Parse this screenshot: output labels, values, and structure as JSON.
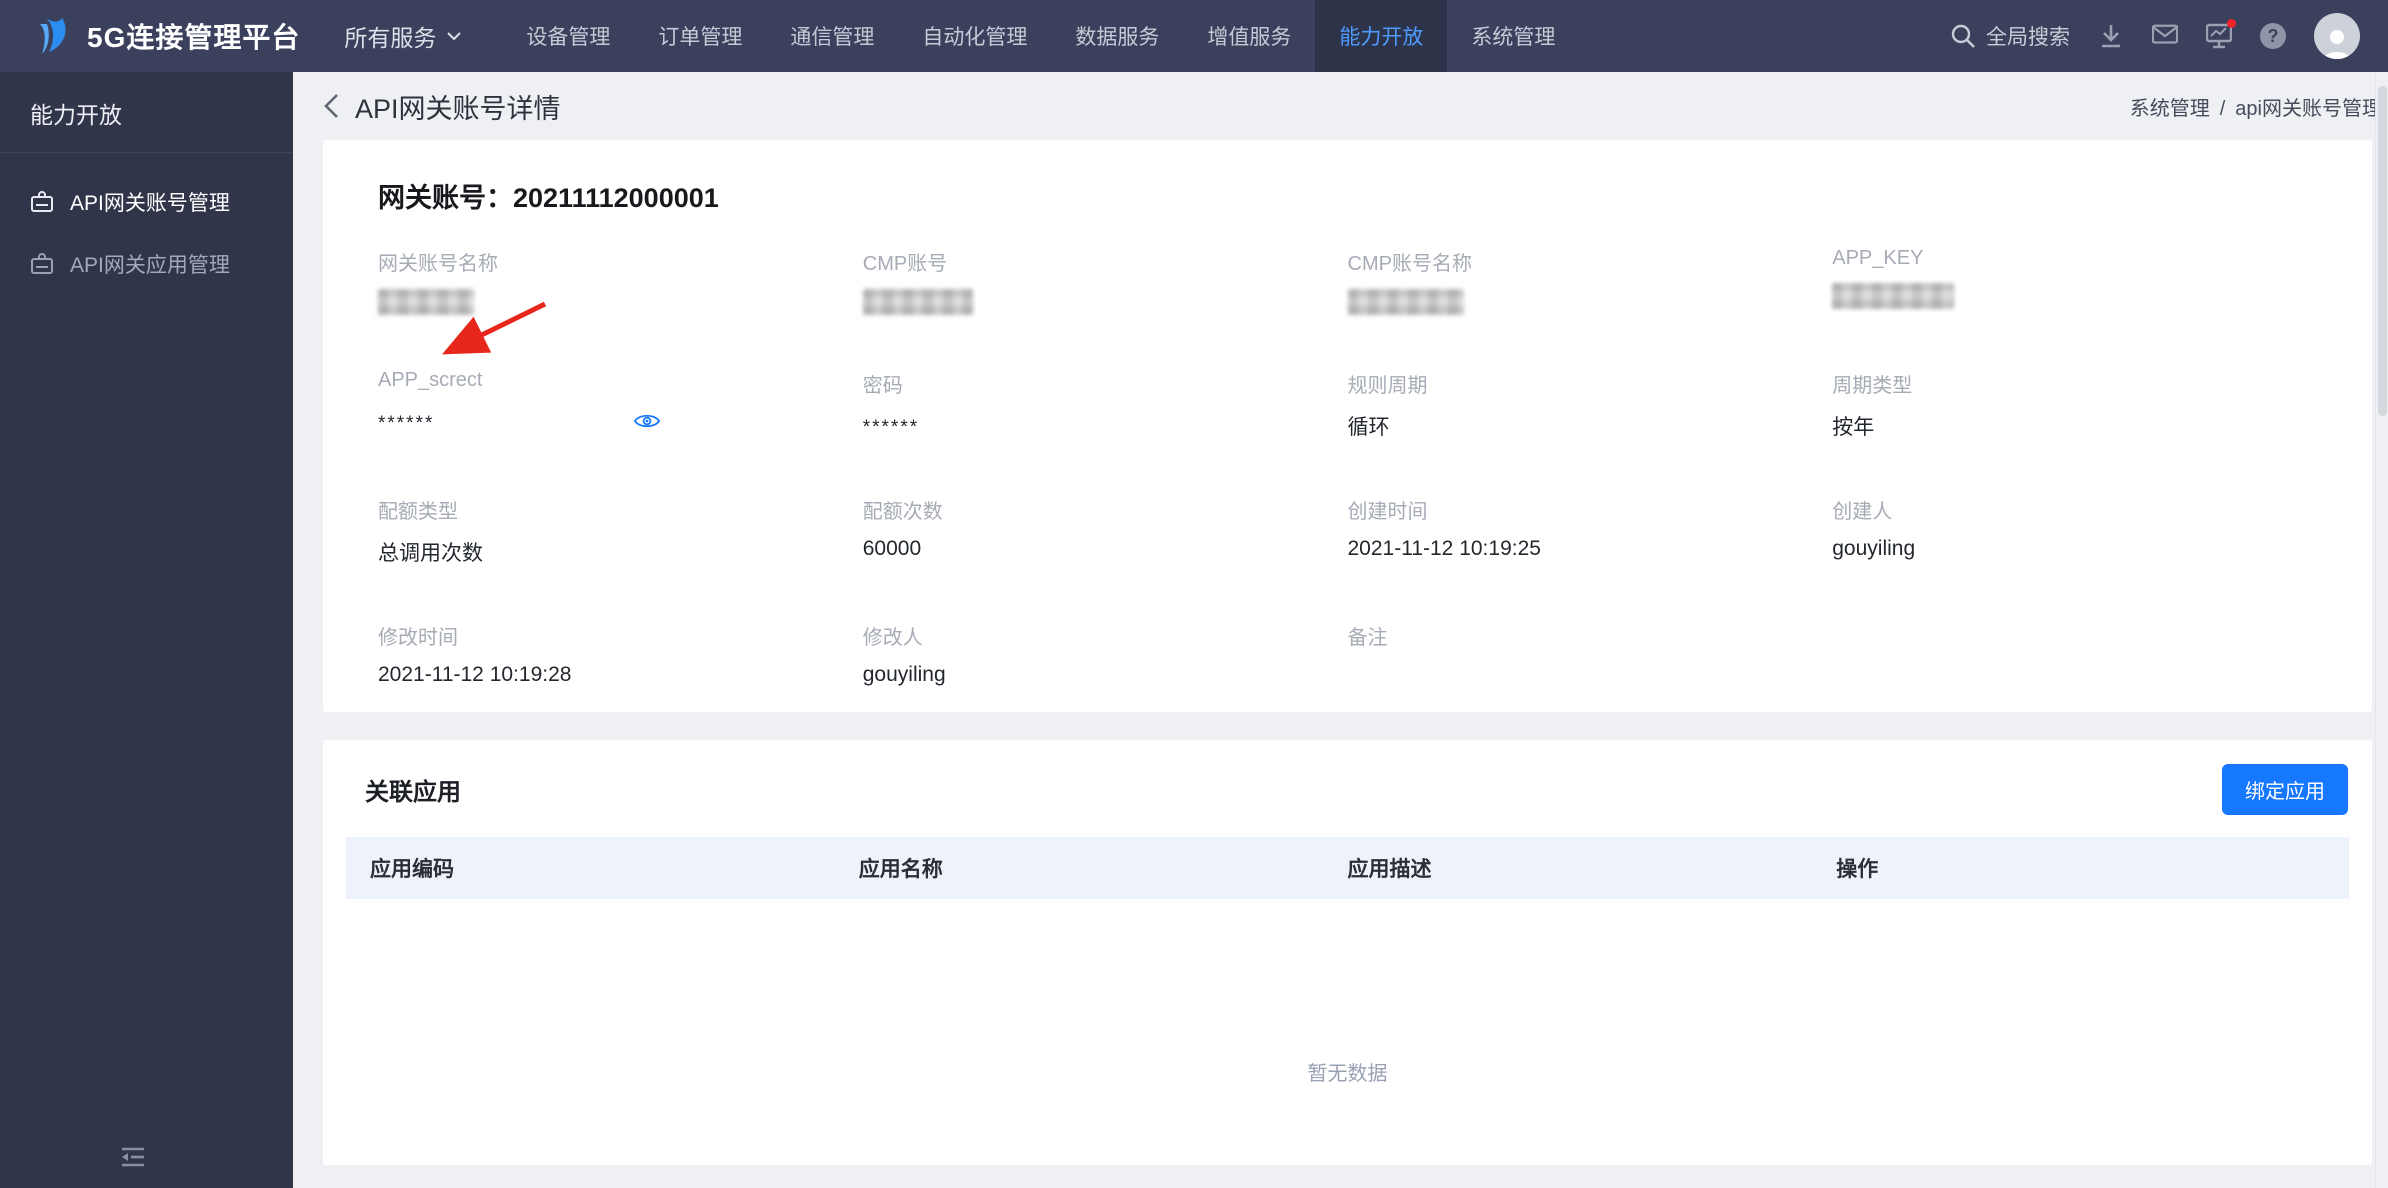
{
  "navbar": {
    "brand": "5G连接管理平台",
    "all_services_label": "所有服务",
    "items": [
      {
        "label": "设备管理",
        "active": false
      },
      {
        "label": "订单管理",
        "active": false
      },
      {
        "label": "通信管理",
        "active": false
      },
      {
        "label": "自动化管理",
        "active": false
      },
      {
        "label": "数据服务",
        "active": false
      },
      {
        "label": "增值服务",
        "active": false
      },
      {
        "label": "能力开放",
        "active": true
      },
      {
        "label": "系统管理",
        "active": false
      }
    ],
    "search_label": "全局搜索",
    "help_glyph": "?"
  },
  "sidebar": {
    "title": "能力开放",
    "items": [
      {
        "label": "API网关账号管理",
        "active": true
      },
      {
        "label": "API网关应用管理",
        "active": false
      }
    ]
  },
  "page_header": {
    "title": "API网关账号详情",
    "breadcrumb": [
      "系统管理",
      "api网关账号管理"
    ]
  },
  "detail_card": {
    "title": "网关账号：20211112000001",
    "fields": [
      {
        "label": "网关账号名称",
        "value": "",
        "redacted": true
      },
      {
        "label": "CMP账号",
        "value": "",
        "redacted": true
      },
      {
        "label": "CMP账号名称",
        "value": "",
        "redacted": true
      },
      {
        "label": "APP_KEY",
        "value": "",
        "redacted": true
      },
      {
        "label": "APP_screct",
        "value": "******",
        "masked": true,
        "eye": true
      },
      {
        "label": "密码",
        "value": "******",
        "masked": true
      },
      {
        "label": "规则周期",
        "value": "循环"
      },
      {
        "label": "周期类型",
        "value": "按年"
      },
      {
        "label": "配额类型",
        "value": "总调用次数"
      },
      {
        "label": "配额次数",
        "value": "60000"
      },
      {
        "label": "创建时间",
        "value": "2021-11-12 10:19:25"
      },
      {
        "label": "创建人",
        "value": "gouyiling"
      },
      {
        "label": "修改时间",
        "value": "2021-11-12 10:19:28"
      },
      {
        "label": "修改人",
        "value": "gouyiling"
      },
      {
        "label": "备注",
        "value": ""
      }
    ]
  },
  "apps_card": {
    "title": "关联应用",
    "bind_button_label": "绑定应用",
    "table_headers": [
      "应用编码",
      "应用名称",
      "应用描述",
      "操作"
    ],
    "empty_text": "暂无数据"
  },
  "colors": {
    "accent_blue": "#1677ff",
    "navbar_bg": "#3b415c",
    "sidebar_bg": "#30354a",
    "active_link": "#4e9bff",
    "danger_red": "#f5222d",
    "annotation_arrow": "#e8271c"
  }
}
